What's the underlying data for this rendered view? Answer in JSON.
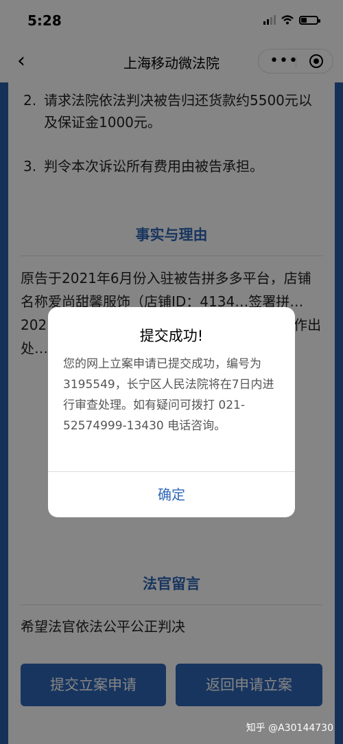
{
  "status_bar": {
    "time": "5:28"
  },
  "nav": {
    "back_glyph": "‹",
    "title": "上海移动微法院",
    "more_glyph": "•••"
  },
  "claims": {
    "item2_num": "2.",
    "item2_text": "请求法院依法判决被告归还货款约5500元以及保证金1000元。",
    "item3_num": "3.",
    "item3_text": "判令本次诉讼所有费用由被告承担。"
  },
  "facts": {
    "title": "事实与理由",
    "text": "原告于2021年6月份入驻被告拼多多平台，店铺名称爱尚甜馨服饰（店铺ID：4134…签署拼…202…尚甜馨服…告对原…认为被…规情形…作出处…院。"
  },
  "message": {
    "title": "法官留言",
    "text": "希望法官依法公平公正判决"
  },
  "buttons": {
    "submit": "提交立案申请",
    "back": "返回申请立案"
  },
  "dialog": {
    "title": "提交成功!",
    "body": "您的网上立案申请已提交成功，编号为 3195549，长宁区人民法院将在7日内进行审查处理。如有疑问可拨打 021-52574999-13430 电话咨询。",
    "confirm": "确定"
  },
  "watermark": "知乎 @A30144730",
  "colors": {
    "accent": "#2e67b7",
    "page_bg": "#2b5ea9"
  }
}
